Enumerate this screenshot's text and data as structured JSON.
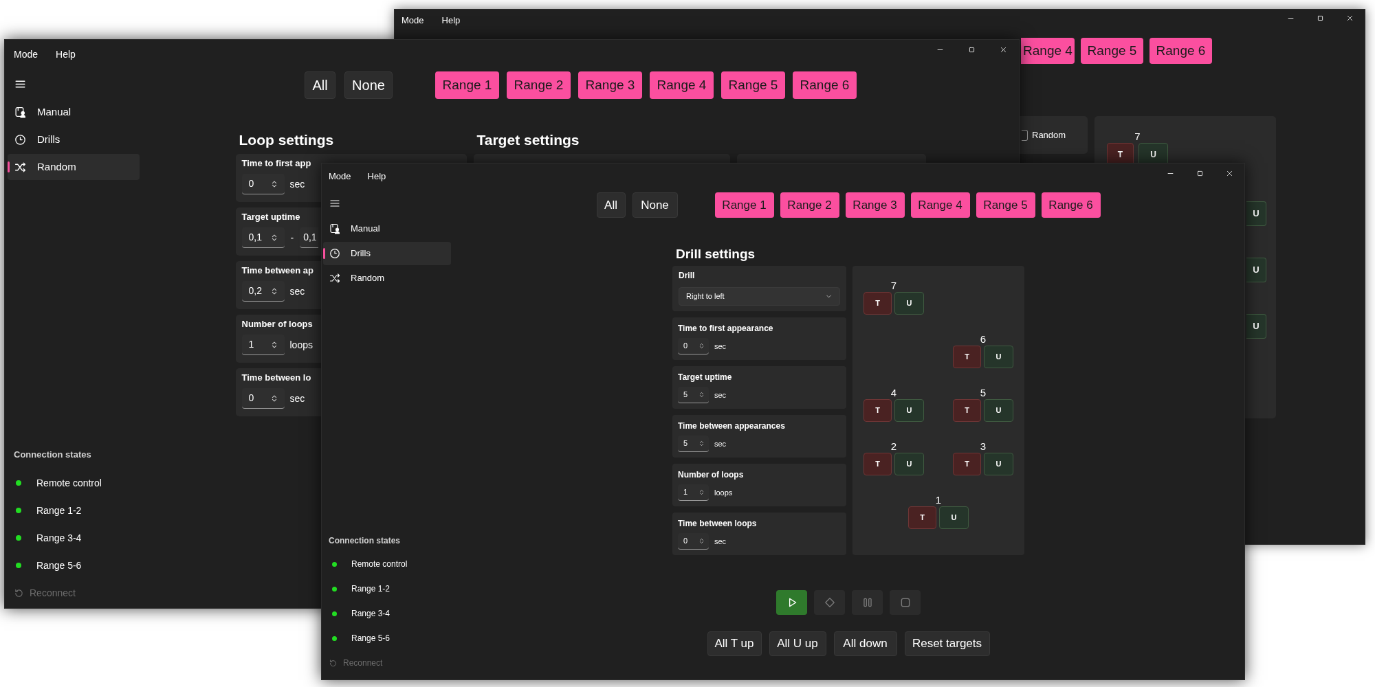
{
  "back_window": {
    "menu": [
      "Mode",
      "Help"
    ],
    "range_buttons": [
      {
        "label": "Range 4",
        "selected": true
      },
      {
        "label": "Range 5",
        "selected": true
      },
      {
        "label": "Range 6",
        "selected": true
      }
    ],
    "random_option": {
      "label": "Random",
      "checked": false
    },
    "top_target": {
      "number": "7",
      "buttons": [
        "T",
        "U"
      ]
    },
    "side_buttons": [
      "U",
      "U",
      "U"
    ]
  },
  "middle_window": {
    "menu": [
      "Mode",
      "Help"
    ],
    "nav": [
      {
        "label": "Manual",
        "kind": "manual",
        "selected": false
      },
      {
        "label": "Drills",
        "kind": "drills",
        "selected": false
      },
      {
        "label": "Random",
        "kind": "random",
        "selected": true
      }
    ],
    "select_buttons": [
      "All",
      "None"
    ],
    "range_buttons": [
      {
        "label": "Range 1",
        "selected": true
      },
      {
        "label": "Range 2",
        "selected": true
      },
      {
        "label": "Range 3",
        "selected": true
      },
      {
        "label": "Range 4",
        "selected": true
      },
      {
        "label": "Range 5",
        "selected": true
      },
      {
        "label": "Range 6",
        "selected": true
      }
    ],
    "loop_settings": {
      "title": "Loop settings",
      "cards": [
        {
          "label": "Time to first app",
          "fields": [
            "0"
          ],
          "unit": "sec"
        },
        {
          "label": "Target uptime",
          "fields": [
            "0,1",
            "0,1"
          ],
          "separator": "-"
        },
        {
          "label": "Time between ap",
          "fields": [
            "0,2"
          ],
          "unit": "sec"
        },
        {
          "label": "Number of loops",
          "fields": [
            "1"
          ],
          "unit": "loops"
        },
        {
          "label": "Time between lo",
          "fields": [
            "0"
          ],
          "unit": "sec"
        }
      ]
    },
    "target_settings": {
      "title": "Target settings"
    },
    "connection": {
      "title": "Connection states",
      "items": [
        {
          "label": "Remote control",
          "connected": true
        },
        {
          "label": "Range 1-2",
          "connected": true
        },
        {
          "label": "Range 3-4",
          "connected": true
        },
        {
          "label": "Range 5-6",
          "connected": true
        }
      ],
      "reconnect": {
        "label": "Reconnect",
        "disabled": true
      }
    }
  },
  "front_window": {
    "menu": [
      "Mode",
      "Help"
    ],
    "nav": [
      {
        "label": "Manual",
        "kind": "manual",
        "selected": false
      },
      {
        "label": "Drills",
        "kind": "drills",
        "selected": true
      },
      {
        "label": "Random",
        "kind": "random",
        "selected": false
      }
    ],
    "select_buttons": [
      "All",
      "None"
    ],
    "range_buttons": [
      {
        "label": "Range 1",
        "selected": true
      },
      {
        "label": "Range 2",
        "selected": true
      },
      {
        "label": "Range 3",
        "selected": true
      },
      {
        "label": "Range 4",
        "selected": true
      },
      {
        "label": "Range 5",
        "selected": true
      },
      {
        "label": "Range 6",
        "selected": true
      }
    ],
    "drill_settings": {
      "title": "Drill settings",
      "drill": {
        "label": "Drill",
        "value": "Right to left"
      },
      "cards": [
        {
          "label": "Time to first appearance",
          "value": "0",
          "unit": "sec"
        },
        {
          "label": "Target uptime",
          "value": "5",
          "unit": "sec"
        },
        {
          "label": "Time between appearances",
          "value": "5",
          "unit": "sec"
        },
        {
          "label": "Number of loops",
          "value": "1",
          "unit": "loops"
        },
        {
          "label": "Time between loops",
          "value": "0",
          "unit": "sec"
        }
      ],
      "targets": [
        {
          "number": "7",
          "buttons": [
            "T",
            "U"
          ]
        },
        {
          "number": "6",
          "buttons": [
            "T",
            "U"
          ]
        },
        {
          "number": "4",
          "buttons": [
            "T",
            "U"
          ]
        },
        {
          "number": "5",
          "buttons": [
            "T",
            "U"
          ]
        },
        {
          "number": "2",
          "buttons": [
            "T",
            "U"
          ]
        },
        {
          "number": "3",
          "buttons": [
            "T",
            "U"
          ]
        },
        {
          "number": "1",
          "buttons": [
            "T",
            "U"
          ]
        }
      ]
    },
    "transport": [
      {
        "kind": "play",
        "disabled": false
      },
      {
        "kind": "mark",
        "disabled": true
      },
      {
        "kind": "pause",
        "disabled": true
      },
      {
        "kind": "stop",
        "disabled": true
      }
    ],
    "actions": [
      "All T up",
      "All U up",
      "All down",
      "Reset targets"
    ],
    "connection": {
      "title": "Connection states",
      "items": [
        {
          "label": "Remote control",
          "connected": true
        },
        {
          "label": "Range 1-2",
          "connected": true
        },
        {
          "label": "Range 3-4",
          "connected": true
        },
        {
          "label": "Range 5-6",
          "connected": true
        }
      ],
      "reconnect": {
        "label": "Reconnect",
        "disabled": true
      }
    }
  }
}
